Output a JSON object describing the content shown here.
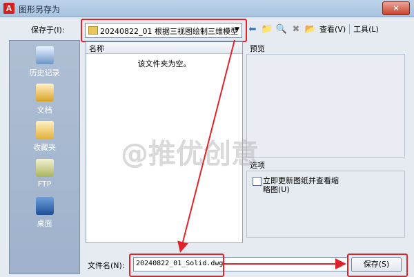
{
  "window": {
    "title": "图形另存为",
    "app_icon": "A",
    "close": "✕"
  },
  "save_in": {
    "label": "保存于(I):",
    "folder": "20240822_01 根据三视图绘制三维模型"
  },
  "toolbar": {
    "view_label": "查看(V)",
    "tools_label": "工具(L)"
  },
  "places": [
    "历史记录",
    "文档",
    "收藏夹",
    "FTP",
    "桌面"
  ],
  "file_list": {
    "column_name": "名称",
    "empty_message": "该文件夹为空。"
  },
  "preview": {
    "label": "预览"
  },
  "options": {
    "label": "选项",
    "checkbox_label": "立即更新图纸并查看缩略图(U)",
    "checked": false
  },
  "file_name": {
    "label": "文件名(N):",
    "value": "20240822_01_Solid.dwg"
  },
  "save_button": {
    "label": "保存(S)"
  },
  "watermark": "@推优创意",
  "colors": {
    "highlight": "#e0232a",
    "places_bg": "#a6b8cf"
  }
}
